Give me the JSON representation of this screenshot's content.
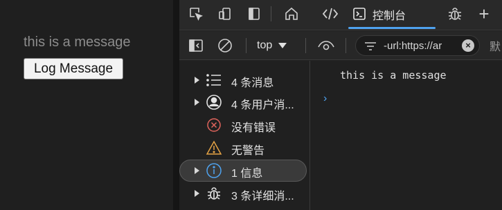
{
  "page": {
    "message": "this is a message",
    "button_label": "Log Message"
  },
  "devtools": {
    "tabs": {
      "console_label": "控制台",
      "add": "+"
    },
    "toolbar": {
      "context": "top",
      "filter_value": "-url:https://ar",
      "more": "默"
    },
    "sidebar": {
      "items": [
        {
          "label": "4 条消息",
          "icon": "list-icon",
          "expandable": true
        },
        {
          "label": "4 条用户消...",
          "icon": "user-icon",
          "expandable": true
        },
        {
          "label": "没有错误",
          "icon": "error-icon",
          "expandable": false
        },
        {
          "label": "无警告",
          "icon": "warning-icon",
          "expandable": false
        },
        {
          "label": "1 信息",
          "icon": "info-icon",
          "expandable": true,
          "selected": true
        },
        {
          "label": "3 条详细消...",
          "icon": "bug-icon",
          "expandable": true
        }
      ]
    },
    "console": {
      "log": "this is a message",
      "prompt": "›"
    },
    "colors": {
      "accent": "#4fa3f0",
      "error": "#e0645c",
      "warning": "#e5a345"
    }
  }
}
